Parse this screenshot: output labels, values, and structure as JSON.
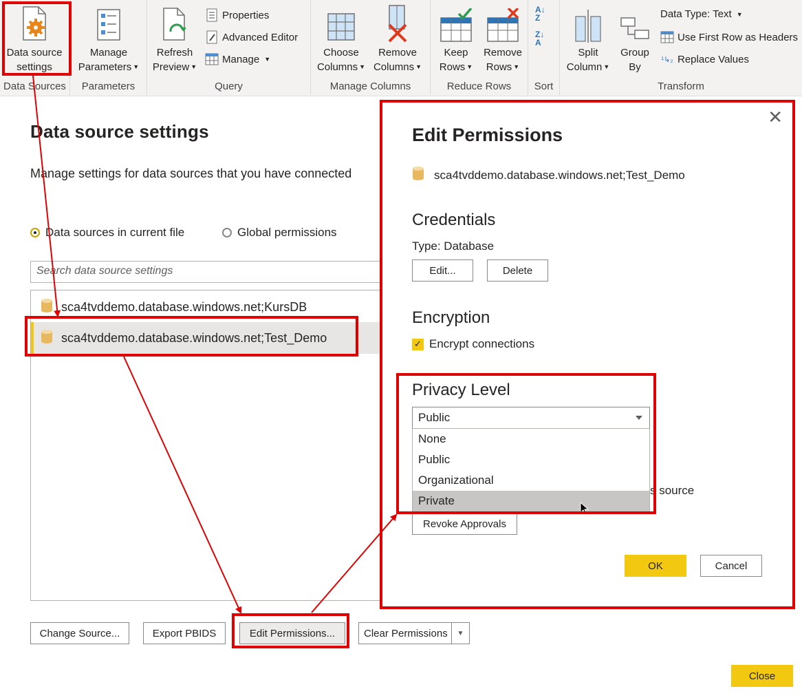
{
  "ribbon": {
    "groups": {
      "data_sources": "Data Sources",
      "parameters": "Parameters",
      "query": "Query",
      "manage_columns": "Manage Columns",
      "reduce_rows": "Reduce Rows",
      "sort": "Sort",
      "transform": "Transform"
    },
    "data_source_settings": [
      "Data source",
      "settings"
    ],
    "manage_parameters": [
      "Manage",
      "Parameters"
    ],
    "refresh_preview": [
      "Refresh",
      "Preview"
    ],
    "properties": "Properties",
    "advanced_editor": "Advanced Editor",
    "manage": "Manage",
    "choose_columns": [
      "Choose",
      "Columns"
    ],
    "remove_columns": [
      "Remove",
      "Columns"
    ],
    "keep_rows": [
      "Keep",
      "Rows"
    ],
    "remove_rows": [
      "Remove",
      "Rows"
    ],
    "split_column": [
      "Split",
      "Column"
    ],
    "group_by": [
      "Group",
      "By"
    ],
    "data_type": "Data Type: Text",
    "use_first_row": "Use First Row as Headers",
    "replace_values": "Replace Values"
  },
  "dialog": {
    "title": "Data source settings",
    "description": "Manage settings for data sources that you have connected",
    "radio_current": "Data sources in current file",
    "radio_global": "Global permissions",
    "search_placeholder": "Search data source settings",
    "sources": [
      "sca4tvddemo.database.windows.net;KursDB",
      "sca4tvddemo.database.windows.net;Test_Demo"
    ],
    "buttons": {
      "change_source": "Change Source...",
      "export_pbids": "Export PBIDS",
      "edit_permissions": "Edit Permissions...",
      "clear_permissions": "Clear Permissions",
      "close": "Close"
    }
  },
  "permissions": {
    "title": "Edit Permissions",
    "source": "sca4tvddemo.database.windows.net;Test_Demo",
    "credentials_heading": "Credentials",
    "credentials_type": "Type: Database",
    "edit_label": "Edit...",
    "delete_label": "Delete",
    "encryption_heading": "Encryption",
    "encrypt_label": "Encrypt connections",
    "privacy_heading": "Privacy Level",
    "privacy_selected": "Public",
    "privacy_options": [
      "None",
      "Public",
      "Organizational",
      "Private"
    ],
    "partial_text": "s source",
    "revoke_label": "Revoke Approvals",
    "ok_label": "OK",
    "cancel_label": "Cancel"
  },
  "colors": {
    "accent": "#f2c811",
    "annotation_red": "#e00000"
  }
}
